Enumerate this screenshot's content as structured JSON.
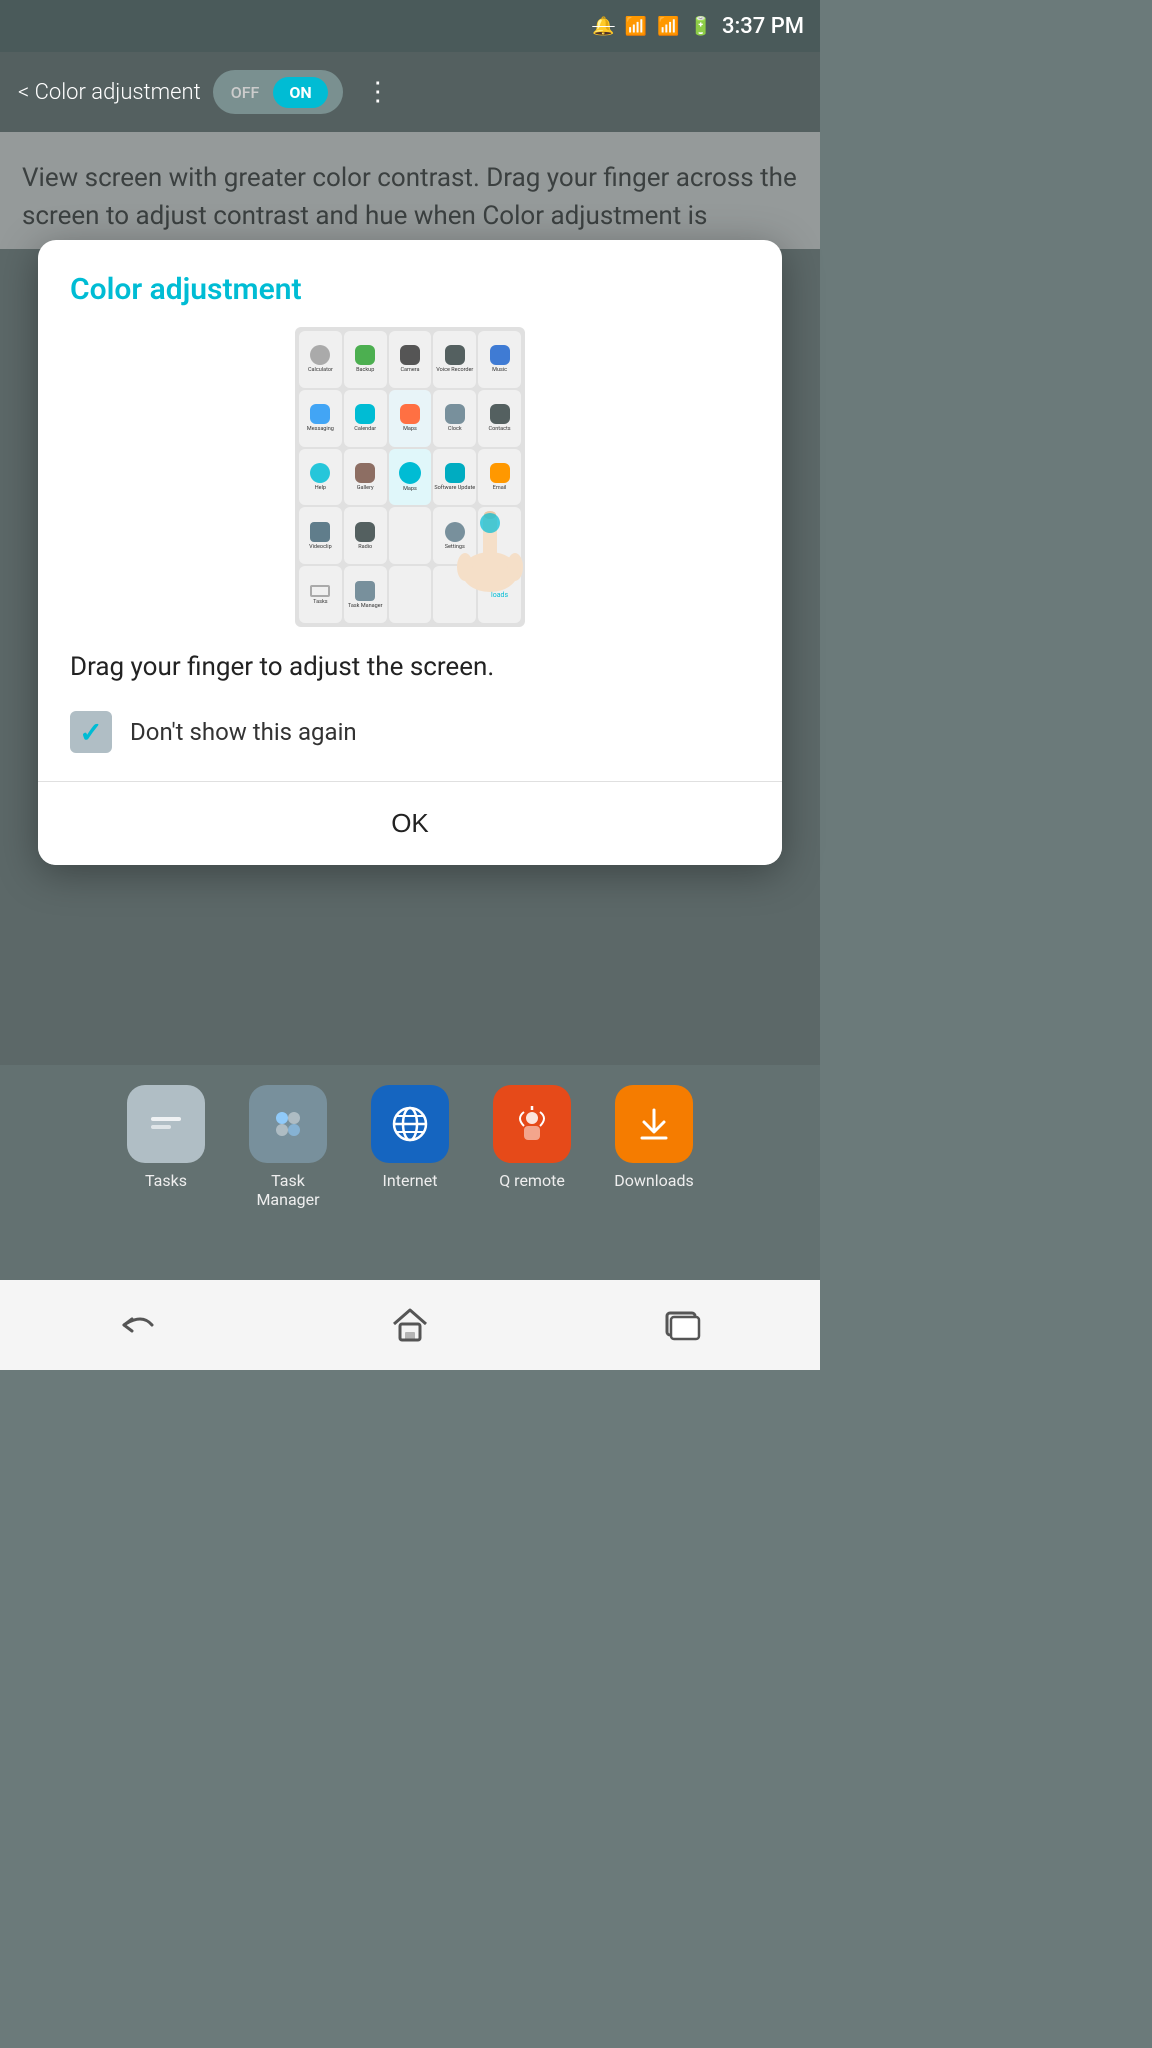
{
  "statusBar": {
    "time": "3:37 PM"
  },
  "appBar": {
    "backLabel": "< Color adjustment",
    "toggleOff": "OFF",
    "toggleOn": "ON",
    "moreIcon": "⋮"
  },
  "bgContent": {
    "text": "View screen with greater color contrast. Drag your finger across the screen to adjust contrast and hue when Color adjustment is"
  },
  "dialog": {
    "title": "Color adjustment",
    "instruction": "Drag your finger to adjust the screen.",
    "checkboxLabel": "Don't show this again",
    "okLabel": "OK"
  },
  "dock": {
    "items": [
      {
        "label": "Tasks",
        "color": "gray"
      },
      {
        "label": "Task Manager",
        "color": "darkgray"
      },
      {
        "label": "Internet",
        "color": "blue"
      },
      {
        "label": "Q remote",
        "color": "orange-red"
      },
      {
        "label": "Downloads",
        "color": "amber"
      }
    ]
  },
  "nav": {
    "back": "↩",
    "home": "⌂",
    "recent": "▭"
  }
}
